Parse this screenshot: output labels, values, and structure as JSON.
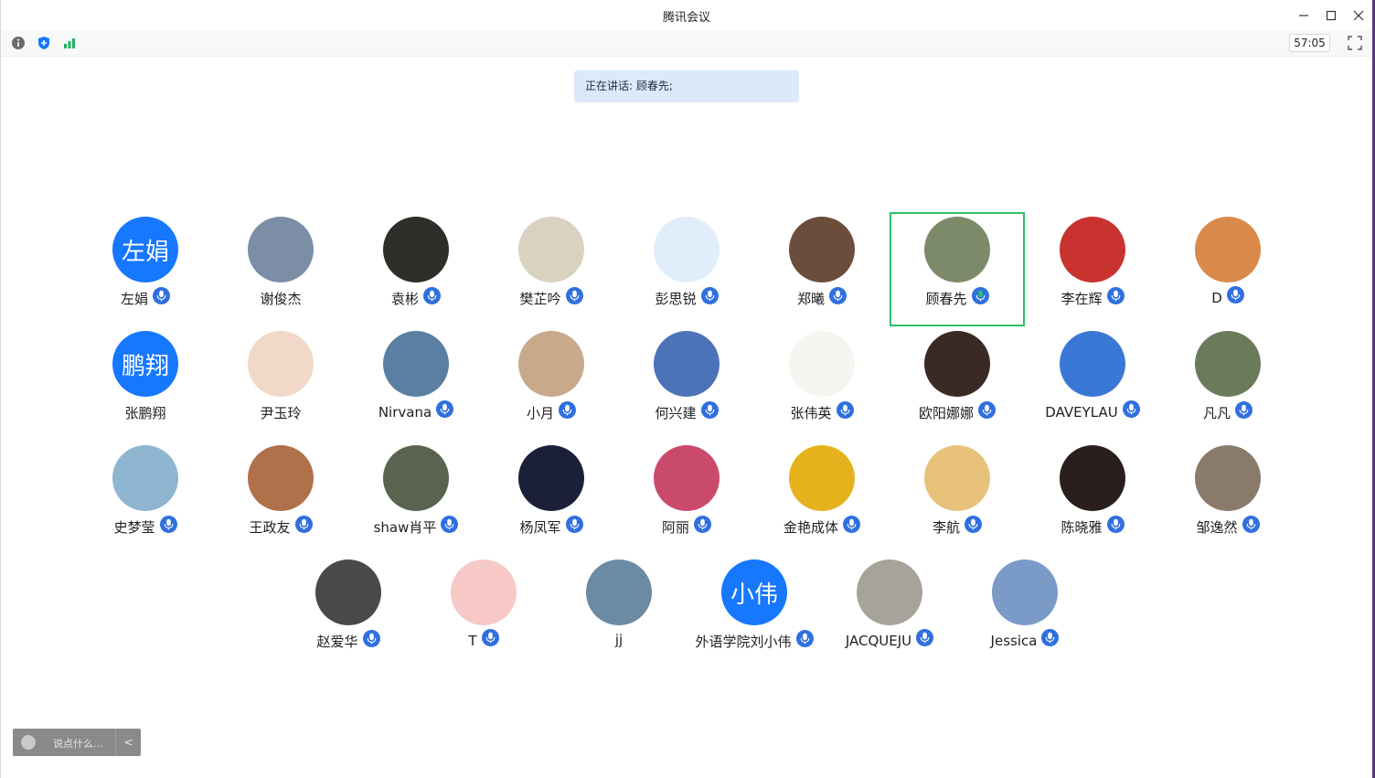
{
  "window": {
    "title": "腾讯会议"
  },
  "toolbar": {
    "timer": "57:05"
  },
  "banner": {
    "text": "正在讲话: 顾春先;"
  },
  "chat": {
    "placeholder": "说点什么...",
    "toggle": "<"
  },
  "participants": [
    {
      "name": "左娟",
      "avatar_text": "左娟",
      "avatar_color": "#1677ff",
      "mic": true
    },
    {
      "name": "谢俊杰",
      "avatar_text": "",
      "avatar_color": "#7b8ea6",
      "mic": false
    },
    {
      "name": "袁彬",
      "avatar_text": "",
      "avatar_color": "#2c2f2a",
      "mic": true
    },
    {
      "name": "樊芷吟",
      "avatar_text": "",
      "avatar_color": "#d9d2c1",
      "mic": true
    },
    {
      "name": "彭思锐",
      "avatar_text": "",
      "avatar_color": "#dfeefa",
      "mic": true
    },
    {
      "name": "郑曦",
      "avatar_text": "",
      "avatar_color": "#6b4d3b",
      "mic": true
    },
    {
      "name": "顾春先",
      "avatar_text": "",
      "avatar_color": "#7d8a6a",
      "mic": true,
      "speaking": true
    },
    {
      "name": "李在辉",
      "avatar_text": "",
      "avatar_color": "#c9332f",
      "mic": true
    },
    {
      "name": "D",
      "avatar_text": "",
      "avatar_color": "#d98a4a",
      "mic": true
    },
    {
      "name": "张鹏翔",
      "avatar_text": "鹏翔",
      "avatar_color": "#1677ff",
      "mic": false
    },
    {
      "name": "尹玉玲",
      "avatar_text": "",
      "avatar_color": "#f1d8c9",
      "mic": false
    },
    {
      "name": "Nirvana",
      "avatar_text": "",
      "avatar_color": "#5b7fa3",
      "mic": true
    },
    {
      "name": "小月",
      "avatar_text": "",
      "avatar_color": "#c9a98b",
      "mic": true
    },
    {
      "name": "何兴建",
      "avatar_text": "",
      "avatar_color": "#4c73b8",
      "mic": true
    },
    {
      "name": "张伟英",
      "avatar_text": "",
      "avatar_color": "#f4f7f0",
      "mic": true
    },
    {
      "name": "欧阳娜娜",
      "avatar_text": "",
      "avatar_color": "#3a2a26",
      "mic": true
    },
    {
      "name": "DAVEYLAU",
      "avatar_text": "",
      "avatar_color": "#3a78d6",
      "mic": true
    },
    {
      "name": "凡凡",
      "avatar_text": "",
      "avatar_color": "#6a7b5a",
      "mic": true
    },
    {
      "name": "史梦莹",
      "avatar_text": "",
      "avatar_color": "#8eb6d1",
      "mic": true
    },
    {
      "name": "王政友",
      "avatar_text": "",
      "avatar_color": "#b0704a",
      "mic": true
    },
    {
      "name": "shaw肖平",
      "avatar_text": "",
      "avatar_color": "#59634f",
      "mic": true
    },
    {
      "name": "杨凤军",
      "avatar_text": "",
      "avatar_color": "#1b1f3a",
      "mic": true
    },
    {
      "name": "阿丽",
      "avatar_text": "",
      "avatar_color": "#c94a6a",
      "mic": true
    },
    {
      "name": "金艳成体",
      "avatar_text": "",
      "avatar_color": "#e5b21e",
      "mic": true
    },
    {
      "name": "李航",
      "avatar_text": "",
      "avatar_color": "#e8c27a",
      "mic": true
    },
    {
      "name": "陈晓雅",
      "avatar_text": "",
      "avatar_color": "#2a1f1d",
      "mic": true
    },
    {
      "name": "邹逸然",
      "avatar_text": "",
      "avatar_color": "#8a7a6a",
      "mic": true
    },
    {
      "name": "赵爱华",
      "avatar_text": "",
      "avatar_color": "#4a4a4a",
      "mic": true
    },
    {
      "name": "T",
      "avatar_text": "",
      "avatar_color": "#f6c9c6",
      "mic": true
    },
    {
      "name": "jj",
      "avatar_text": "",
      "avatar_color": "#6b8aa3",
      "mic": false
    },
    {
      "name": "外语学院刘小伟",
      "avatar_text": "小伟",
      "avatar_color": "#1677ff",
      "mic": true
    },
    {
      "name": "JACQUEJU",
      "avatar_text": "",
      "avatar_color": "#a7a39b",
      "mic": true
    },
    {
      "name": "Jessica",
      "avatar_text": "",
      "avatar_color": "#7a9bc7",
      "mic": true
    }
  ]
}
